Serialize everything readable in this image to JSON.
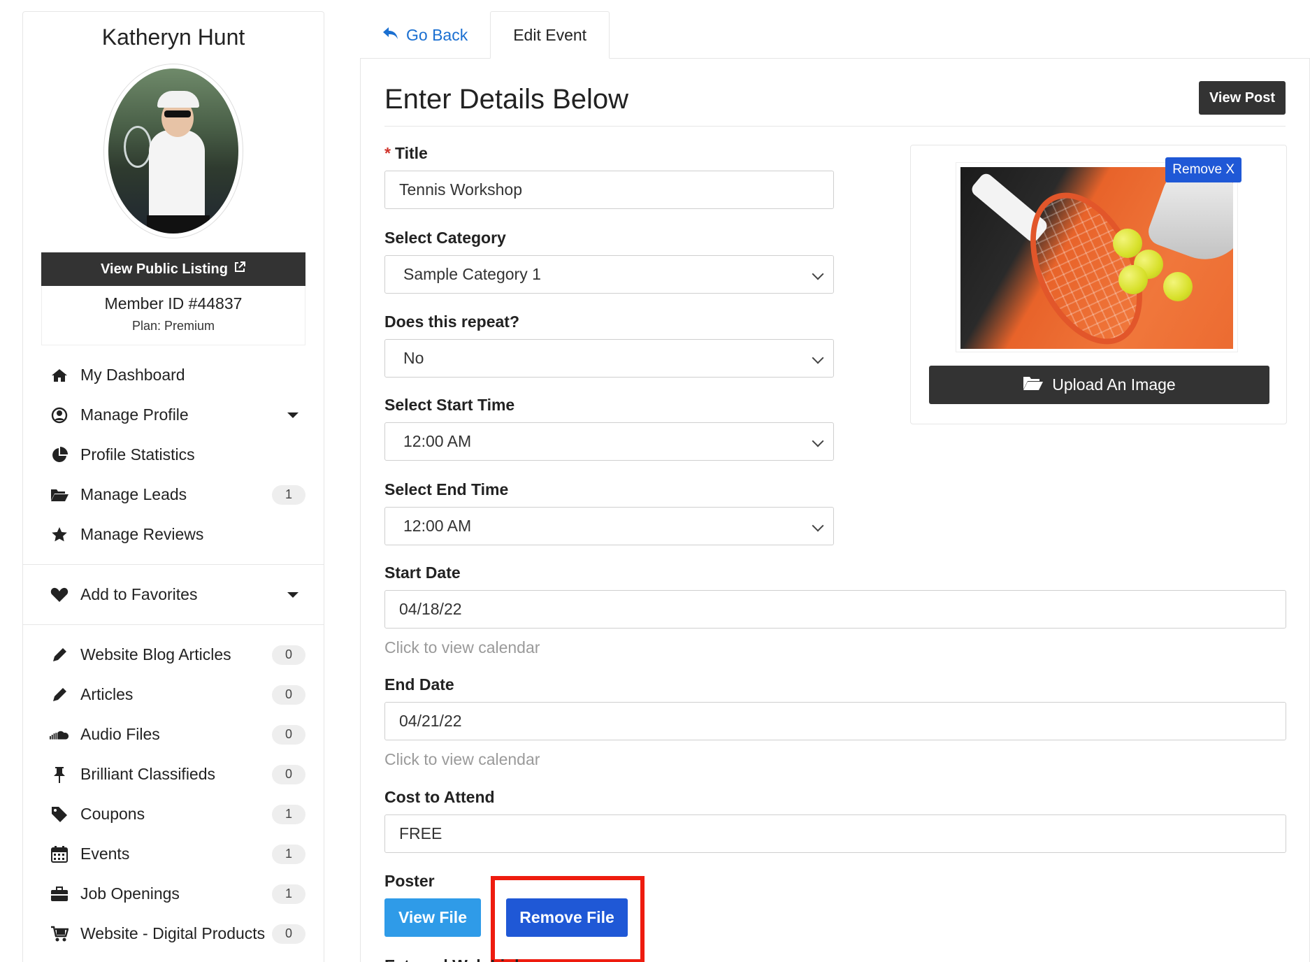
{
  "sidebar": {
    "profile_name": "Katheryn Hunt",
    "public_listing_label": "View Public Listing",
    "member_id": "Member ID #44837",
    "plan": "Plan: Premium",
    "nav_main": [
      {
        "label": "My Dashboard",
        "icon": "home-icon"
      },
      {
        "label": "Manage Profile",
        "icon": "user-circle-icon",
        "dropdown": true
      },
      {
        "label": "Profile Statistics",
        "icon": "pie-chart-icon"
      },
      {
        "label": "Manage Leads",
        "icon": "folder-open-icon",
        "count": "1"
      },
      {
        "label": "Manage Reviews",
        "icon": "star-icon"
      }
    ],
    "favorites": {
      "label": "Add to Favorites",
      "icon": "heart-icon"
    },
    "nav_content": [
      {
        "label": "Website Blog Articles",
        "icon": "pencil-icon",
        "count": "0"
      },
      {
        "label": "Articles",
        "icon": "pencil-icon",
        "count": "0"
      },
      {
        "label": "Audio Files",
        "icon": "soundcloud-icon",
        "count": "0"
      },
      {
        "label": "Brilliant Classifieds",
        "icon": "thumbtack-icon",
        "count": "0"
      },
      {
        "label": "Coupons",
        "icon": "tag-icon",
        "count": "1"
      },
      {
        "label": "Events",
        "icon": "calendar-icon",
        "count": "1"
      },
      {
        "label": "Job Openings",
        "icon": "briefcase-icon",
        "count": "1"
      },
      {
        "label": "Website - Digital Products",
        "icon": "cart-icon",
        "count": "0"
      }
    ]
  },
  "tabs": {
    "go_back": "Go Back",
    "edit_event": "Edit Event"
  },
  "form": {
    "heading": "Enter Details Below",
    "view_post": "View Post",
    "title_label": "Title",
    "title_required_mark": "*",
    "title_value": "Tennis Workshop",
    "category_label": "Select Category",
    "category_value": "Sample Category 1",
    "repeat_label": "Does this repeat?",
    "repeat_value": "No",
    "start_time_label": "Select Start Time",
    "start_time_value": "12:00 AM",
    "end_time_label": "Select End Time",
    "end_time_value": "12:00 AM",
    "start_date_label": "Start Date",
    "start_date_value": "04/18/22",
    "start_date_hint": "Click to view calendar",
    "end_date_label": "End Date",
    "end_date_value": "04/21/22",
    "end_date_hint": "Click to view calendar",
    "cost_label": "Cost to Attend",
    "cost_value": "FREE",
    "poster_label": "Poster",
    "view_file": "View File",
    "remove_file": "Remove File",
    "external_link_label": "External Web Link"
  },
  "image_card": {
    "remove_label": "Remove X",
    "upload_label": "Upload An Image"
  },
  "colors": {
    "accent_blue": "#1f58d6",
    "link_blue": "#1a6fd1",
    "view_file_blue": "#2f9be8",
    "dark_button": "#333333",
    "highlight_red": "#ee1c0f",
    "required_red": "#d0342c"
  }
}
